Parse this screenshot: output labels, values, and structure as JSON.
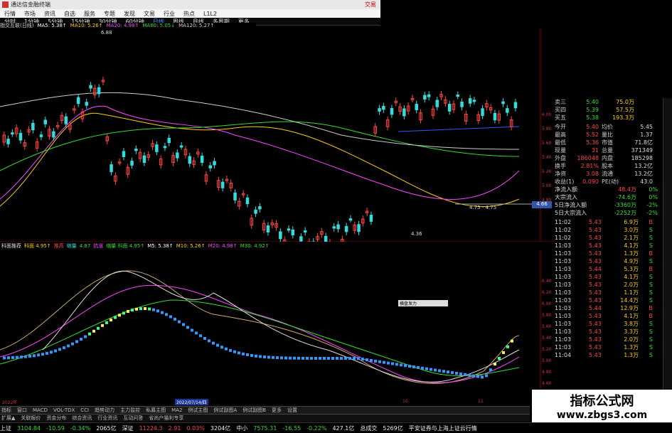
{
  "app_title": "通达信金融终端",
  "top_right_label": "交易",
  "menu": [
    "行情",
    "市场",
    "资讯",
    "自选",
    "服务",
    "专题",
    "发现",
    "文易",
    "行业",
    "热点",
    "L1L2"
  ],
  "periods": [
    "分时",
    "1分钟",
    "5分钟",
    "15分钟",
    "30分钟",
    "60分钟",
    "日线",
    "周线",
    "月线",
    "多周期",
    "更多"
  ],
  "ma_line": {
    "name": "指交互联(日线)",
    "ma5": "MA5: 5.38↑",
    "ma10": "MA10: 5.26↑",
    "ma20": "MA20: 4.98↑",
    "ma60": "MA60: 5.05↓",
    "ma120": "MA120: 5.27↑"
  },
  "price_labels": {
    "high": "6.88",
    "low": "4.36",
    "range": "4.75 - 4.75",
    "current": "4.66"
  },
  "y_axis_top": [
    "6.00",
    "5.80",
    "5.60",
    "5.40",
    "5.20",
    "5.00",
    "4.80"
  ],
  "indicator_line": [
    "科面推荐",
    "科面 4.95↑",
    "推高",
    "缩量",
    "4.87",
    "抗涨",
    "缩量 科面 4.95↑",
    "M5: 5.38↑",
    "M10: 5.26↑",
    "M20: 4.98↑",
    "M30: 4.92↑"
  ],
  "y_axis_bottom": [
    "6.40",
    "6.20",
    "6.00",
    "5.80",
    "5.60",
    "5.40",
    "5.20",
    "5.00",
    "4.80",
    "4.60"
  ],
  "tooltip": "横盘发力",
  "x_axis": {
    "left": "2022年",
    "date": "2022/07/14/四",
    "m10": "10",
    "m11": "11"
  },
  "quote": [
    {
      "label": "卖三",
      "price": "5.40",
      "vol": "75.0万"
    },
    {
      "label": "买四",
      "price": "5.39",
      "vol": "57.5万"
    },
    {
      "label": "买五",
      "price": "5.38",
      "vol": "193.3万"
    }
  ],
  "stats": [
    {
      "a": "今开",
      "b": "5.40",
      "c": "均价",
      "d": "5.45"
    },
    {
      "a": "最高",
      "b": "5.52",
      "c": "量比",
      "d": "1.37"
    },
    {
      "a": "最低",
      "b": "5.36",
      "c": "市值",
      "d": "71.8亿"
    },
    {
      "a": "现量",
      "b": "31",
      "c": "总量",
      "d": "371349"
    },
    {
      "a": "外盘",
      "b": "186048",
      "c": "内盘",
      "d": "185298"
    },
    {
      "a": "换手",
      "b": "2.81%",
      "c": "股本",
      "d": "13.2亿"
    },
    {
      "a": "净资",
      "b": "3.08",
      "c": "流通",
      "d": "13.2亿"
    },
    {
      "a": "收益(1)",
      "b": "0.090",
      "c": "PE(动)",
      "d": "43.0"
    }
  ],
  "flows": [
    {
      "a": "净流入额",
      "b": "48.4万",
      "c": "0%"
    },
    {
      "a": "大宗流入",
      "b": "-74.6万",
      "c": "0%"
    },
    {
      "a": "5日净流入额",
      "b": "-3360万",
      "c": "-2%"
    },
    {
      "a": "5日大宗流入",
      "b": "-2252万",
      "c": "-2%"
    }
  ],
  "ticks": [
    {
      "t": "11:02",
      "p": "5.43",
      "v": "6.9万",
      "d": "B"
    },
    {
      "t": "11:02",
      "p": "5.43",
      "v": "3.0万",
      "d": "S"
    },
    {
      "t": "11:02",
      "p": "5.43",
      "v": "2.1万",
      "d": "S"
    },
    {
      "t": "11:03",
      "p": "5.43",
      "v": "4.1万",
      "d": "S"
    },
    {
      "t": "11:03",
      "p": "5.43",
      "v": "1.3万",
      "d": "B"
    },
    {
      "t": "11:03",
      "p": "5.43",
      "v": "4.9万",
      "d": "S"
    },
    {
      "t": "11:03",
      "p": "5.44",
      "v": "5.3万",
      "d": "B"
    },
    {
      "t": "11:03",
      "p": "5.43",
      "v": "4.1万",
      "d": "S"
    },
    {
      "t": "11:03",
      "p": "5.43",
      "v": "2.0万",
      "d": "S"
    },
    {
      "t": "11:03",
      "p": "5.43",
      "v": "1.1万",
      "d": "S"
    },
    {
      "t": "11:03",
      "p": "5.43",
      "v": "14.4万",
      "d": "S"
    },
    {
      "t": "11:03",
      "p": "5.44",
      "v": "12.9万",
      "d": "B"
    },
    {
      "t": "11:03",
      "p": "5.43",
      "v": "4.1万",
      "d": "B"
    },
    {
      "t": "11:03",
      "p": "5.43",
      "v": "3.8万",
      "d": "S"
    },
    {
      "t": "11:03",
      "p": "5.43",
      "v": "3.3万",
      "d": "S"
    },
    {
      "t": "11:03",
      "p": "5.43",
      "v": "2.0万",
      "d": "S"
    },
    {
      "t": "11:03",
      "p": "5.43",
      "v": "1.3万",
      "d": "S"
    },
    {
      "t": "11:04",
      "p": "5.43",
      "v": "1.3万",
      "d": "S"
    }
  ],
  "bottom_tabs": [
    "指标",
    "窗口",
    "MACD",
    "VOL-TDX",
    "CCI",
    "趋势动力",
    "主力监控",
    "私募主图",
    "MA2",
    "例试主图",
    "例试副图A",
    "例试副图B",
    "更多",
    "设置"
  ],
  "bottom_tabs2": [
    "扩展▲",
    "关联报价",
    "资金分布",
    "综合资讯",
    "行业资讯",
    "互动问答",
    "省尚户猫利专享"
  ],
  "status": {
    "sh": "上证",
    "sh_v": "3104.84",
    "sh_c": "-10.59",
    "sh_p": "-0.34%",
    "sh_a": "2065亿",
    "sz": "深证",
    "sz_v": "11224.3",
    "sz_c": "2.91",
    "sz_p": "0.03%",
    "sz_a": "3204亿",
    "zx": "中小",
    "zx_v": "7575.31",
    "zx_c": "-16.55",
    "zx_p": "-0.22%",
    "zx_a": "427.1亿",
    "tot": "总成交",
    "tot_v": "5269亿",
    "notice": "平安证券与上海上证云行情"
  },
  "watermark": {
    "title": "指标公式网",
    "url": "www.zbgs3.com"
  },
  "colors": {
    "red": "#ff4444",
    "green": "#33dd33",
    "cyan": "#33dddd"
  }
}
